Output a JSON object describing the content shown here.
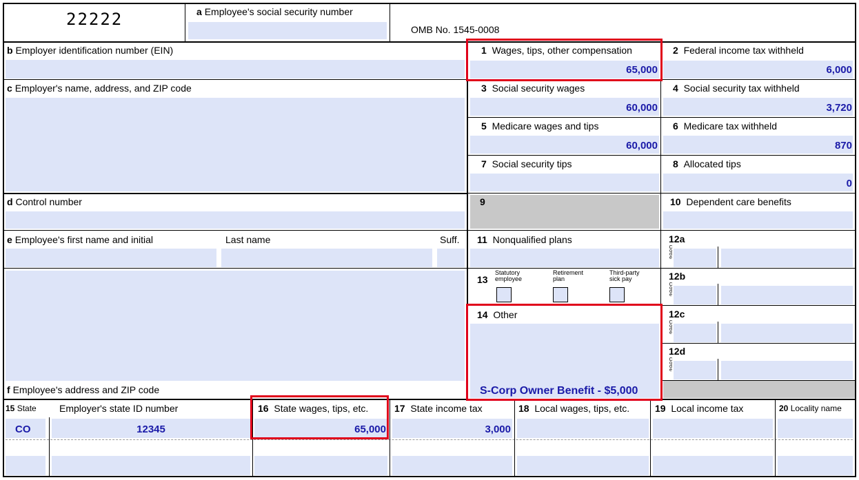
{
  "form_code": "22222",
  "omb": "OMB No. 1545-0008",
  "fields": {
    "a": {
      "letter": "a",
      "label": "Employee's social security number"
    },
    "b": {
      "letter": "b",
      "label": "Employer identification number (EIN)"
    },
    "c": {
      "letter": "c",
      "label": "Employer's name, address, and ZIP code"
    },
    "d": {
      "letter": "d",
      "label": "Control number"
    },
    "e": {
      "letter": "e",
      "label": "Employee's first name and initial",
      "last": "Last name",
      "suff": "Suff."
    },
    "f": {
      "letter": "f",
      "label": "Employee's address and ZIP code"
    }
  },
  "boxes": {
    "b1": {
      "num": "1",
      "label": "Wages, tips, other compensation",
      "value": "65,000"
    },
    "b2": {
      "num": "2",
      "label": "Federal income tax withheld",
      "value": "6,000"
    },
    "b3": {
      "num": "3",
      "label": "Social security wages",
      "value": "60,000"
    },
    "b4": {
      "num": "4",
      "label": "Social security tax withheld",
      "value": "3,720"
    },
    "b5": {
      "num": "5",
      "label": "Medicare wages and tips",
      "value": "60,000"
    },
    "b6": {
      "num": "6",
      "label": "Medicare tax withheld",
      "value": "870"
    },
    "b7": {
      "num": "7",
      "label": "Social security tips",
      "value": ""
    },
    "b8": {
      "num": "8",
      "label": "Allocated tips",
      "value": "0"
    },
    "b9": {
      "num": "9"
    },
    "b10": {
      "num": "10",
      "label": "Dependent care benefits"
    },
    "b11": {
      "num": "11",
      "label": "Nonqualified plans"
    },
    "b12a": {
      "num": "12a"
    },
    "b12b": {
      "num": "12b"
    },
    "b12c": {
      "num": "12c"
    },
    "b12d": {
      "num": "12d"
    },
    "code_letters": [
      "C",
      "o",
      "d",
      "e"
    ],
    "b13": {
      "num": "13",
      "statutory": [
        "Statutory",
        "employee"
      ],
      "retirement": [
        "Retirement",
        "plan"
      ],
      "thirdparty": [
        "Third-party",
        "sick pay"
      ]
    },
    "b14": {
      "num": "14",
      "label": "Other",
      "value": "S-Corp Owner Benefit - $5,000"
    }
  },
  "state_row": {
    "b15": {
      "num": "15",
      "label": "State",
      "value": "CO"
    },
    "ein_state": {
      "label": "Employer's state ID number",
      "value": "12345"
    },
    "b16": {
      "num": "16",
      "label": "State wages, tips, etc.",
      "value": "65,000"
    },
    "b17": {
      "num": "17",
      "label": "State income tax",
      "value": "3,000"
    },
    "b18": {
      "num": "18",
      "label": "Local wages, tips, etc."
    },
    "b19": {
      "num": "19",
      "label": "Local income tax"
    },
    "b20": {
      "num": "20",
      "label": "Locality name"
    }
  },
  "colors": {
    "fill": "#dde4f8",
    "value_text": "#1a1aa8",
    "highlight": "#e0001a",
    "shade": "#c8c8c8"
  }
}
